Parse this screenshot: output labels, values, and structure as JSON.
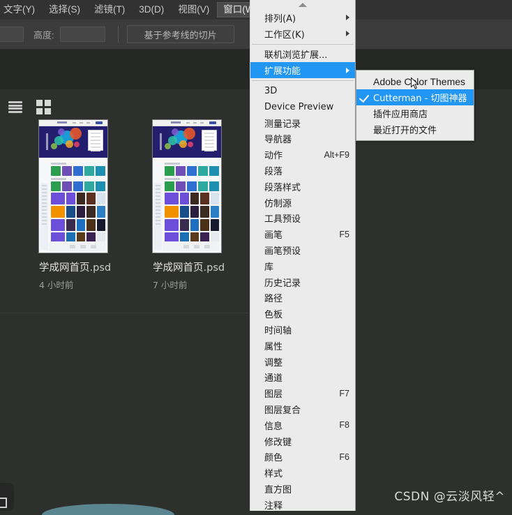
{
  "menubar": {
    "items": [
      {
        "label": "文字(Y)",
        "active": false
      },
      {
        "label": "选择(S)",
        "active": false
      },
      {
        "label": "滤镜(T)",
        "active": false
      },
      {
        "label": "3D(D)",
        "active": false
      },
      {
        "label": "视图(V)",
        "active": false
      },
      {
        "label": "窗口(W)",
        "active": true
      }
    ]
  },
  "options_bar": {
    "height_label": "高度:",
    "width_value": "",
    "height_value": "",
    "slice_button": "基于参考线的切片"
  },
  "browser": {
    "view_toggles": {
      "list_icon": "list-view-icon",
      "grid_icon": "grid-view-icon"
    },
    "files": [
      {
        "name": "学成网首页",
        "ext": ".psd",
        "date": "4 小时前"
      },
      {
        "name": "学成网首页",
        "ext": ".psd",
        "date": "7 小时前"
      }
    ]
  },
  "window_menu": {
    "scroll_up_icon": "chevron-up-icon",
    "items": [
      {
        "label": "排列(A)",
        "shortcut": "",
        "submenu": true,
        "selected": false,
        "separator_after": false
      },
      {
        "label": "工作区(K)",
        "shortcut": "",
        "submenu": true,
        "selected": false,
        "separator_after": true
      },
      {
        "label": "联机浏览扩展...",
        "shortcut": "",
        "submenu": false,
        "selected": false,
        "separator_after": false
      },
      {
        "label": "扩展功能",
        "shortcut": "",
        "submenu": true,
        "selected": true,
        "separator_after": true
      },
      {
        "label": "3D",
        "shortcut": "",
        "submenu": false,
        "selected": false,
        "separator_after": false
      },
      {
        "label": "Device Preview",
        "shortcut": "",
        "submenu": false,
        "selected": false,
        "separator_after": false
      },
      {
        "label": "测量记录",
        "shortcut": "",
        "submenu": false,
        "selected": false,
        "separator_after": false
      },
      {
        "label": "导航器",
        "shortcut": "",
        "submenu": false,
        "selected": false,
        "separator_after": false
      },
      {
        "label": "动作",
        "shortcut": "Alt+F9",
        "submenu": false,
        "selected": false,
        "separator_after": false
      },
      {
        "label": "段落",
        "shortcut": "",
        "submenu": false,
        "selected": false,
        "separator_after": false
      },
      {
        "label": "段落样式",
        "shortcut": "",
        "submenu": false,
        "selected": false,
        "separator_after": false
      },
      {
        "label": "仿制源",
        "shortcut": "",
        "submenu": false,
        "selected": false,
        "separator_after": false
      },
      {
        "label": "工具预设",
        "shortcut": "",
        "submenu": false,
        "selected": false,
        "separator_after": false
      },
      {
        "label": "画笔",
        "shortcut": "F5",
        "submenu": false,
        "selected": false,
        "separator_after": false
      },
      {
        "label": "画笔预设",
        "shortcut": "",
        "submenu": false,
        "selected": false,
        "separator_after": false
      },
      {
        "label": "库",
        "shortcut": "",
        "submenu": false,
        "selected": false,
        "separator_after": false
      },
      {
        "label": "历史记录",
        "shortcut": "",
        "submenu": false,
        "selected": false,
        "separator_after": false
      },
      {
        "label": "路径",
        "shortcut": "",
        "submenu": false,
        "selected": false,
        "separator_after": false
      },
      {
        "label": "色板",
        "shortcut": "",
        "submenu": false,
        "selected": false,
        "separator_after": false
      },
      {
        "label": "时间轴",
        "shortcut": "",
        "submenu": false,
        "selected": false,
        "separator_after": false
      },
      {
        "label": "属性",
        "shortcut": "",
        "submenu": false,
        "selected": false,
        "separator_after": false
      },
      {
        "label": "调整",
        "shortcut": "",
        "submenu": false,
        "selected": false,
        "separator_after": false
      },
      {
        "label": "通道",
        "shortcut": "",
        "submenu": false,
        "selected": false,
        "separator_after": false
      },
      {
        "label": "图层",
        "shortcut": "F7",
        "submenu": false,
        "selected": false,
        "separator_after": false
      },
      {
        "label": "图层复合",
        "shortcut": "",
        "submenu": false,
        "selected": false,
        "separator_after": false
      },
      {
        "label": "信息",
        "shortcut": "F8",
        "submenu": false,
        "selected": false,
        "separator_after": false
      },
      {
        "label": "修改键",
        "shortcut": "",
        "submenu": false,
        "selected": false,
        "separator_after": false
      },
      {
        "label": "颜色",
        "shortcut": "F6",
        "submenu": false,
        "selected": false,
        "separator_after": false
      },
      {
        "label": "样式",
        "shortcut": "",
        "submenu": false,
        "selected": false,
        "separator_after": false
      },
      {
        "label": "直方图",
        "shortcut": "",
        "submenu": false,
        "selected": false,
        "separator_after": false
      },
      {
        "label": "注释",
        "shortcut": "",
        "submenu": false,
        "selected": false,
        "separator_after": false
      }
    ]
  },
  "extensions_submenu": {
    "items": [
      {
        "label": "Adobe Color Themes",
        "checked": false,
        "selected": false,
        "latin": true
      },
      {
        "label": "Cutterman - 切图神器",
        "checked": true,
        "selected": true,
        "latin": false
      },
      {
        "label": "插件应用商店",
        "checked": false,
        "selected": false,
        "latin": false
      },
      {
        "label": "最近打开的文件",
        "checked": false,
        "selected": false,
        "latin": false
      }
    ]
  },
  "watermark": {
    "text": "CSDN @云淡风轻^"
  },
  "colors": {
    "accent": "#2196f3",
    "app_bg": "#2e302e",
    "menu_bg": "#ebebeb",
    "chrome": "#323232"
  }
}
